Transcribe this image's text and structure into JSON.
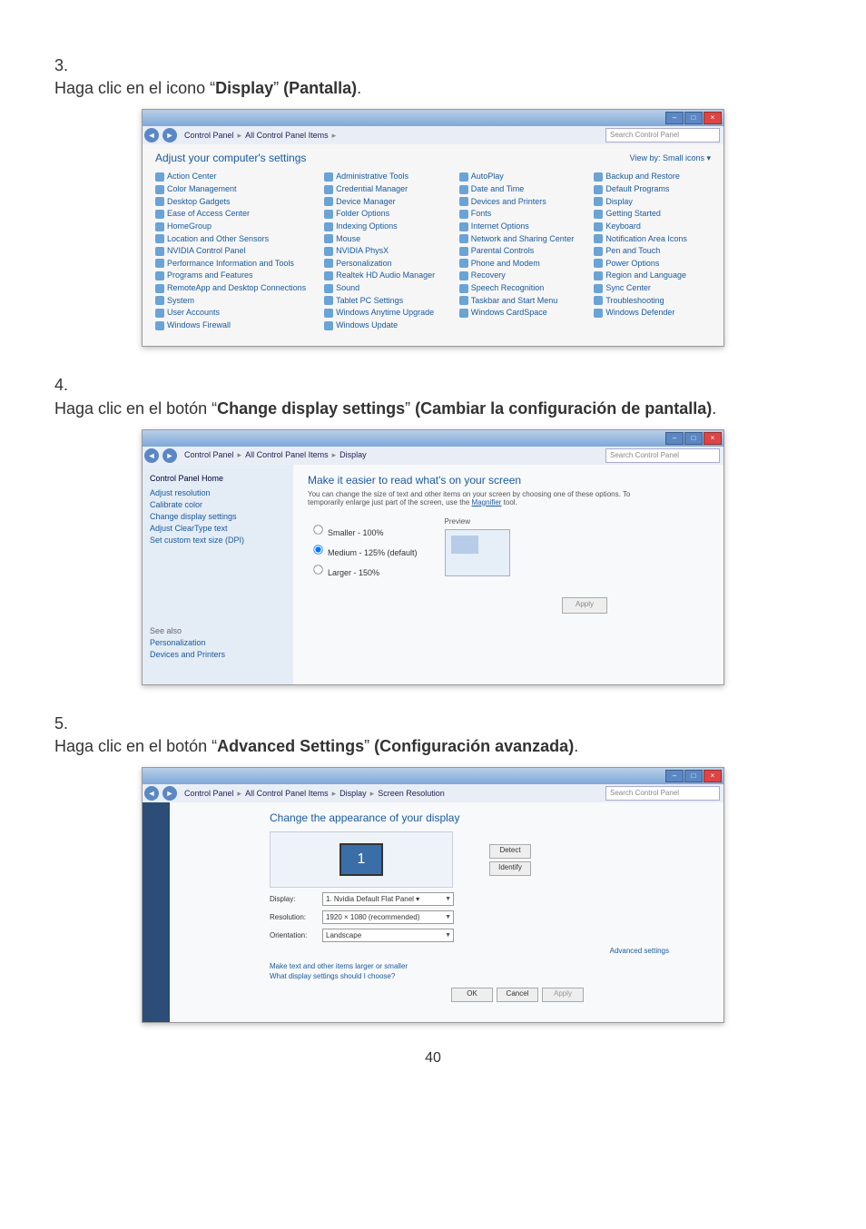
{
  "page_number": "40",
  "steps": {
    "s3": {
      "num": "3.",
      "pre": "Haga clic en el icono “",
      "bold": "Display",
      "post": "” ",
      "paren": "(Pantalla)",
      "end": "."
    },
    "s4": {
      "num": "4.",
      "pre": "Haga clic en el botón “",
      "bold": "Change display settings",
      "post": "” ",
      "paren": "(Cambiar la configuración de pantalla)",
      "end": "."
    },
    "s5": {
      "num": "5.",
      "pre": "Haga clic en el botón “",
      "bold": "Advanced Settings",
      "post": "” ",
      "paren": "(Configuración avanzada)",
      "end": "."
    }
  },
  "shot1": {
    "breadcrumb": [
      "Control Panel",
      "All Control Panel Items"
    ],
    "search_ph": "Search Control Panel",
    "title": "Adjust your computer's settings",
    "view": "View by:  Small icons ▾",
    "cols": [
      [
        "Action Center",
        "Color Management",
        "Desktop Gadgets",
        "Ease of Access Center",
        "HomeGroup",
        "Location and Other Sensors",
        "NVIDIA Control Panel",
        "Performance Information and Tools",
        "Programs and Features",
        "RemoteApp and Desktop Connections",
        "System",
        "User Accounts",
        "Windows Firewall"
      ],
      [
        "Administrative Tools",
        "Credential Manager",
        "Device Manager",
        "Folder Options",
        "Indexing Options",
        "Mouse",
        "NVIDIA PhysX",
        "Personalization",
        "Realtek HD Audio Manager",
        "Sound",
        "Tablet PC Settings",
        "Windows Anytime Upgrade",
        "Windows Update"
      ],
      [
        "AutoPlay",
        "Date and Time",
        "Devices and Printers",
        "Fonts",
        "Internet Options",
        "Network and Sharing Center",
        "Parental Controls",
        "Phone and Modem",
        "Recovery",
        "Speech Recognition",
        "Taskbar and Start Menu",
        "Windows CardSpace"
      ],
      [
        "Backup and Restore",
        "Default Programs",
        "Display",
        "Getting Started",
        "Keyboard",
        "Notification Area Icons",
        "Pen and Touch",
        "Power Options",
        "Region and Language",
        "Sync Center",
        "Troubleshooting",
        "Windows Defender"
      ]
    ]
  },
  "shot2": {
    "breadcrumb": [
      "Control Panel",
      "All Control Panel Items",
      "Display"
    ],
    "search_ph": "Search Control Panel",
    "side_home": "Control Panel Home",
    "side_links": [
      "Adjust resolution",
      "Calibrate color",
      "Change display settings",
      "Adjust ClearType text",
      "Set custom text size (DPI)"
    ],
    "see_also_hdr": "See also",
    "see_also": [
      "Personalization",
      "Devices and Printers"
    ],
    "heading": "Make it easier to read what's on your screen",
    "subtext_a": "You can change the size of text and other items on your screen by choosing one of these options. To temporarily enlarge just part of the screen, use the ",
    "magnifier": "Magnifier",
    "subtext_b": " tool.",
    "radios": [
      "Smaller - 100%",
      "Medium - 125% (default)",
      "Larger - 150%"
    ],
    "radio_selected": 1,
    "preview_label": "Preview",
    "apply": "Apply"
  },
  "shot3": {
    "breadcrumb": [
      "Control Panel",
      "All Control Panel Items",
      "Display",
      "Screen Resolution"
    ],
    "search_ph": "Search Control Panel",
    "heading": "Change the appearance of your display",
    "detect": "Detect",
    "identify": "Identify",
    "rows": {
      "display": {
        "label": "Display:",
        "value": "1. Nvidia Default Flat Panel ▾"
      },
      "resolution": {
        "label": "Resolution:",
        "value": "1920 × 1080 (recommended)"
      },
      "orientation": {
        "label": "Orientation:",
        "value": "Landscape"
      }
    },
    "advanced": "Advanced settings",
    "link1": "Make text and other items larger or smaller",
    "link2": "What display settings should I choose?",
    "ok": "OK",
    "cancel": "Cancel",
    "apply": "Apply"
  }
}
